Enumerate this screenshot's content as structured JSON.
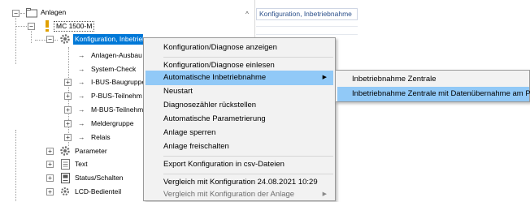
{
  "tree": {
    "scroll_up_glyph": "^",
    "nodes": {
      "anlagen": "Anlagen",
      "mc1500": "MC 1500-M",
      "konfiguration": "Konfiguration, Inbetrieb",
      "anlagen_ausbau": "Anlagen-Ausbau",
      "system_check": "System-Check",
      "ibus": "I-BUS-Baugruppe",
      "pbus": "P-BUS-Teilnehm",
      "mbus": "M-BUS-Teilnehm",
      "meldergruppe": "Meldergruppe",
      "relais": "Relais",
      "parameter": "Parameter",
      "text": "Text",
      "status": "Status/Schalten",
      "lcd": "LCD-Bedienteil"
    },
    "expander_plus": "+",
    "expander_minus": "−",
    "arrow_glyph": "→"
  },
  "right_pane": {
    "column_header": "Konfiguration, Inbetriebnahme"
  },
  "context_menu": {
    "items": [
      {
        "label": "Konfiguration/Diagnose anzeigen"
      },
      {
        "label": "Konfiguration/Diagnose einlesen"
      },
      {
        "label": "Automatische Inbetriebnahme",
        "submenu_arrow": "▶"
      },
      {
        "label": "Neustart"
      },
      {
        "label": "Diagnosezähler rückstellen"
      },
      {
        "label": "Automatische Parametrierung"
      },
      {
        "label": "Anlage sperren"
      },
      {
        "label": "Anlage freischalten"
      },
      {
        "label": "Export Konfiguration in csv-Dateien"
      },
      {
        "label": "Vergleich mit  Konfiguration 24.08.2021 10:29"
      },
      {
        "label": "Vergleich mit Konfiguration der Anlage",
        "submenu_arrow": "▶"
      }
    ]
  },
  "submenu": {
    "items": [
      {
        "label": "Inbetriebnahme Zentrale"
      },
      {
        "label": "Inbetriebnahme Zentrale mit Datenübernahme am PC"
      }
    ]
  },
  "colors": {
    "selection": "#0078d7",
    "menu_highlight": "#91c9f7",
    "menu_background": "#f2f2f2",
    "gear_icon": "#6e6e6e",
    "warning_icon": "#e0a000"
  }
}
